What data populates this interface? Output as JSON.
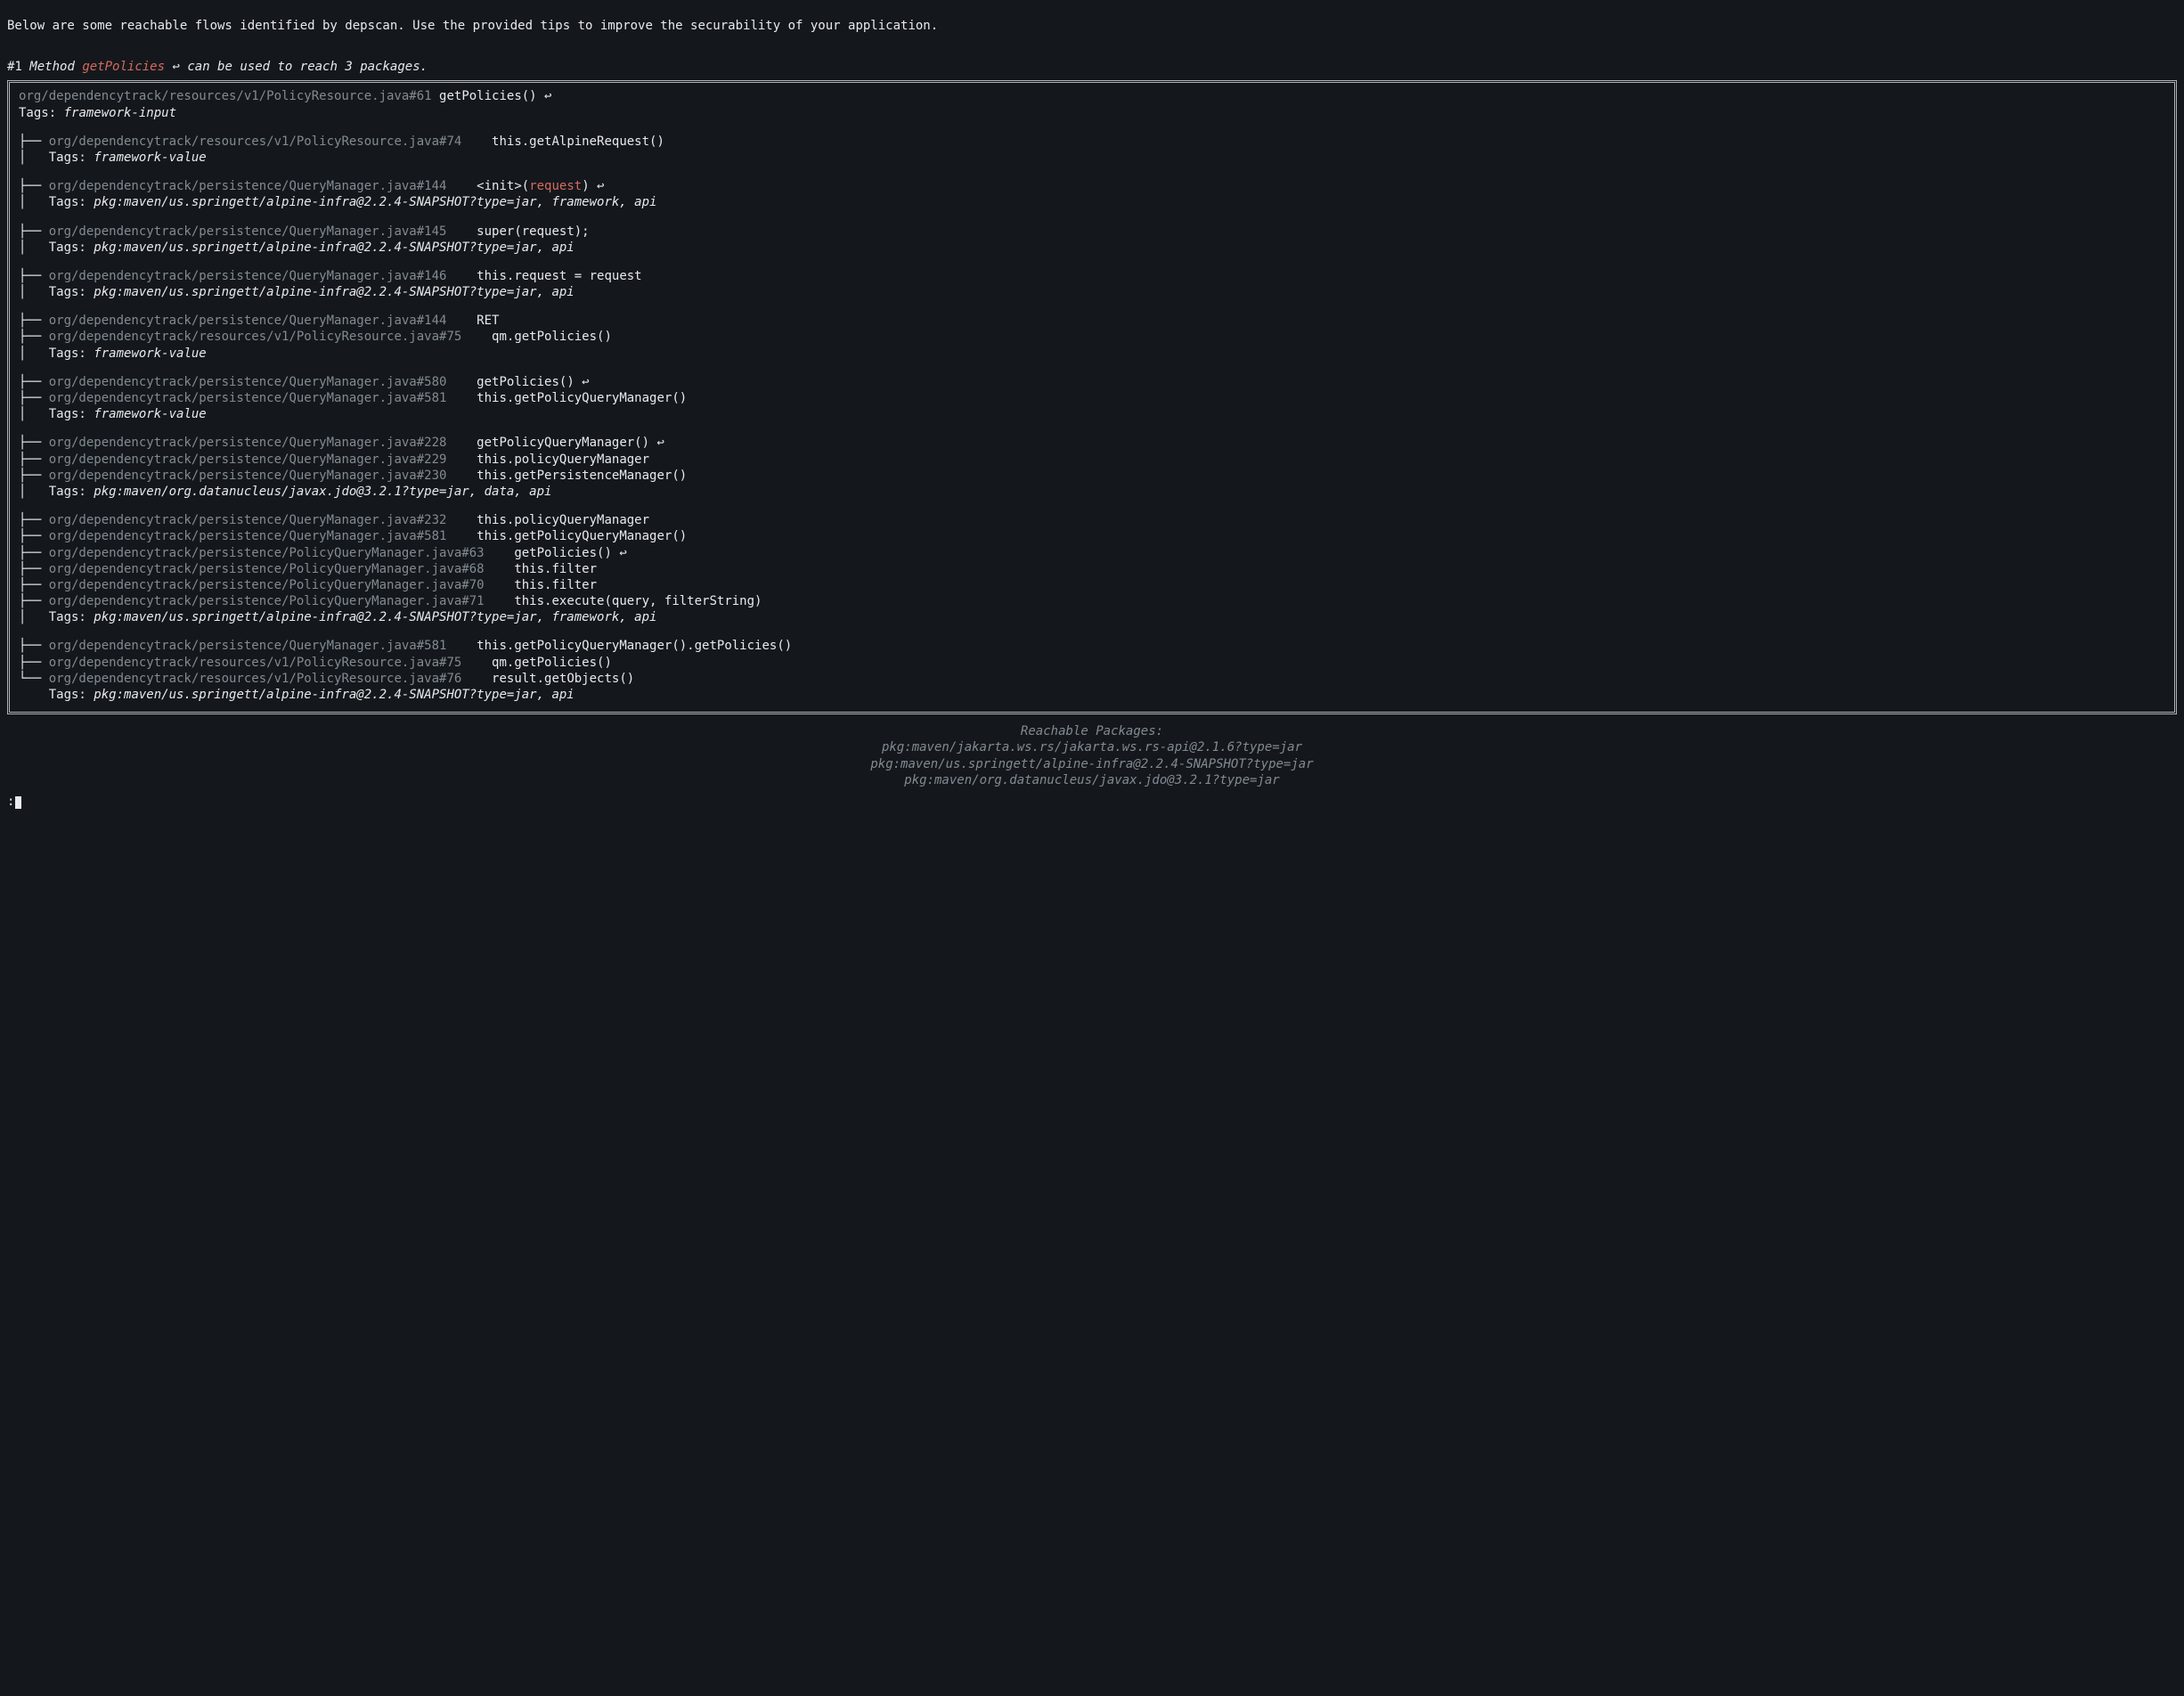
{
  "intro": "Below are some reachable flows identified by depscan. Use the provided tips to improve the securability of your application.",
  "flow": {
    "index": "#1",
    "label_method": "Method",
    "method_name": "getPolicies",
    "arrow": "↩",
    "suffix": "can be used to reach 3 packages.",
    "root": {
      "path": "org/dependencytrack/resources/v1/PolicyResource.java#61",
      "call": "getPolicies() ↩",
      "tags_label": "Tags:",
      "tags": "framework-input"
    },
    "groups": [
      {
        "lines": [
          {
            "prefix": "├── ",
            "path": "org/dependencytrack/resources/v1/PolicyResource.java#74",
            "call": "this.getAlpineRequest()"
          }
        ],
        "tags_prefix": "│   ",
        "tags": "framework-value"
      },
      {
        "lines": [
          {
            "prefix": "├── ",
            "path": "org/dependencytrack/persistence/QueryManager.java#144",
            "call_pre": "<init>(",
            "call_hl": "request",
            "call_post": ") ↩"
          }
        ],
        "tags_prefix": "│   ",
        "tags": "pkg:maven/us.springett/alpine-infra@2.2.4-SNAPSHOT?type=jar, framework, api"
      },
      {
        "lines": [
          {
            "prefix": "├── ",
            "path": "org/dependencytrack/persistence/QueryManager.java#145",
            "call": "super(request);"
          }
        ],
        "tags_prefix": "│   ",
        "tags": "pkg:maven/us.springett/alpine-infra@2.2.4-SNAPSHOT?type=jar, api"
      },
      {
        "lines": [
          {
            "prefix": "├── ",
            "path": "org/dependencytrack/persistence/QueryManager.java#146",
            "call": "this.request = request"
          }
        ],
        "tags_prefix": "│   ",
        "tags": "pkg:maven/us.springett/alpine-infra@2.2.4-SNAPSHOT?type=jar, api"
      },
      {
        "lines": [
          {
            "prefix": "├── ",
            "path": "org/dependencytrack/persistence/QueryManager.java#144",
            "call": "RET"
          },
          {
            "prefix": "├── ",
            "path": "org/dependencytrack/resources/v1/PolicyResource.java#75",
            "call": "qm.getPolicies()"
          }
        ],
        "tags_prefix": "│   ",
        "tags": "framework-value"
      },
      {
        "lines": [
          {
            "prefix": "├── ",
            "path": "org/dependencytrack/persistence/QueryManager.java#580",
            "call": "getPolicies() ↩"
          },
          {
            "prefix": "├── ",
            "path": "org/dependencytrack/persistence/QueryManager.java#581",
            "call": "this.getPolicyQueryManager()"
          }
        ],
        "tags_prefix": "│   ",
        "tags": "framework-value"
      },
      {
        "lines": [
          {
            "prefix": "├── ",
            "path": "org/dependencytrack/persistence/QueryManager.java#228",
            "call": "getPolicyQueryManager() ↩"
          },
          {
            "prefix": "├── ",
            "path": "org/dependencytrack/persistence/QueryManager.java#229",
            "call": "this.policyQueryManager"
          },
          {
            "prefix": "├── ",
            "path": "org/dependencytrack/persistence/QueryManager.java#230",
            "call": "this.getPersistenceManager()"
          }
        ],
        "tags_prefix": "│   ",
        "tags": "pkg:maven/org.datanucleus/javax.jdo@3.2.1?type=jar, data, api"
      },
      {
        "lines": [
          {
            "prefix": "├── ",
            "path": "org/dependencytrack/persistence/QueryManager.java#232",
            "call": "this.policyQueryManager"
          },
          {
            "prefix": "├── ",
            "path": "org/dependencytrack/persistence/QueryManager.java#581",
            "call": "this.getPolicyQueryManager()"
          },
          {
            "prefix": "├── ",
            "path": "org/dependencytrack/persistence/PolicyQueryManager.java#63",
            "call": "getPolicies() ↩"
          },
          {
            "prefix": "├── ",
            "path": "org/dependencytrack/persistence/PolicyQueryManager.java#68",
            "call": "this.filter"
          },
          {
            "prefix": "├── ",
            "path": "org/dependencytrack/persistence/PolicyQueryManager.java#70",
            "call": "this.filter"
          },
          {
            "prefix": "├── ",
            "path": "org/dependencytrack/persistence/PolicyQueryManager.java#71",
            "call": "this.execute(query, filterString)"
          }
        ],
        "tags_prefix": "│   ",
        "tags": "pkg:maven/us.springett/alpine-infra@2.2.4-SNAPSHOT?type=jar, framework, api"
      },
      {
        "lines": [
          {
            "prefix": "├── ",
            "path": "org/dependencytrack/persistence/QueryManager.java#581",
            "call": "this.getPolicyQueryManager().getPolicies()"
          },
          {
            "prefix": "├── ",
            "path": "org/dependencytrack/resources/v1/PolicyResource.java#75",
            "call": "qm.getPolicies()"
          },
          {
            "prefix": "└── ",
            "path": "org/dependencytrack/resources/v1/PolicyResource.java#76",
            "call": "result.getObjects()"
          }
        ],
        "tags_prefix": "    ",
        "tags": "pkg:maven/us.springett/alpine-infra@2.2.4-SNAPSHOT?type=jar, api"
      }
    ]
  },
  "reachable": {
    "title": "Reachable Packages:",
    "packages": [
      "pkg:maven/jakarta.ws.rs/jakarta.ws.rs-api@2.1.6?type=jar",
      "pkg:maven/us.springett/alpine-infra@2.2.4-SNAPSHOT?type=jar",
      "pkg:maven/org.datanucleus/javax.jdo@3.2.1?type=jar"
    ]
  },
  "prompt": ":"
}
